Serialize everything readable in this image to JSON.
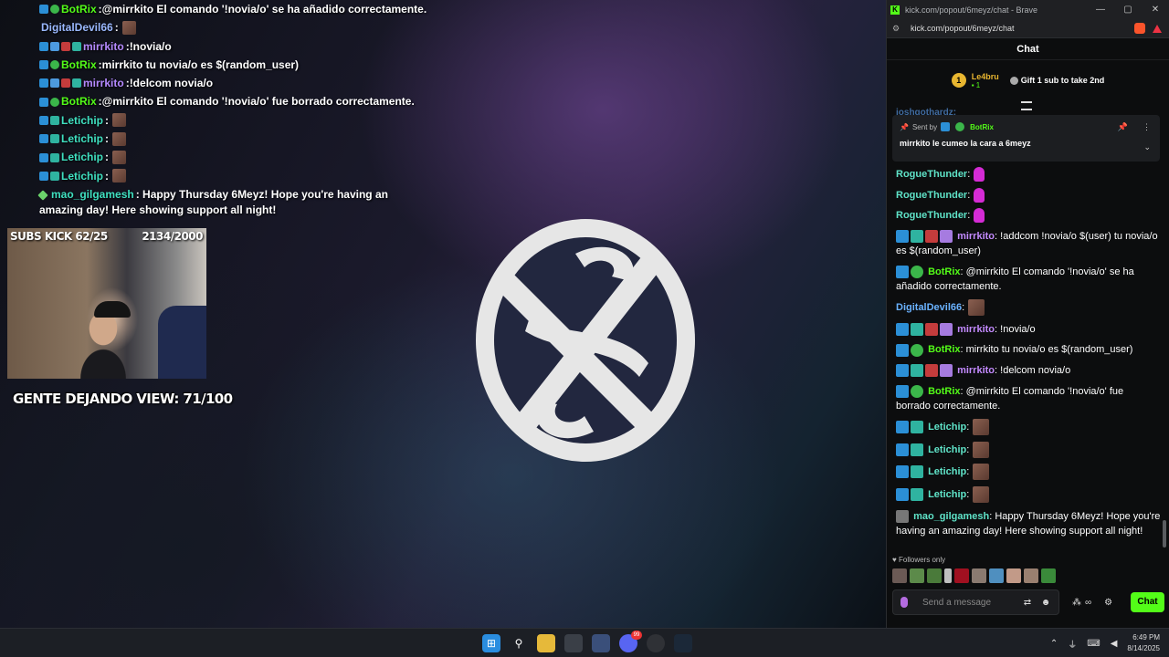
{
  "overlay": {
    "lines": [
      {
        "user": "BotRix",
        "sep": ":",
        "text": " @mirrkito El comando '!novia/o' se ha añadido correctamente.",
        "color": "green"
      },
      {
        "user": "DigitalDevil66",
        "sep": ":",
        "text": "",
        "color": "lblue"
      },
      {
        "user": "mirrkito",
        "sep": ":",
        "text": " !novia/o",
        "color": "purple"
      },
      {
        "user": "BotRix",
        "sep": ":",
        "text": " mirrkito tu novia/o es $(random_user)",
        "color": "green"
      },
      {
        "user": "mirrkito",
        "sep": ":",
        "text": " !delcom novia/o",
        "color": "purple"
      },
      {
        "user": "BotRix",
        "sep": ":",
        "text": " @mirrkito El comando '!novia/o' fue borrado correctamente.",
        "color": "green"
      },
      {
        "user": "Letichip",
        "sep": ":",
        "text": "",
        "color": "teal"
      },
      {
        "user": "Letichip",
        "sep": ":",
        "text": "",
        "color": "teal"
      },
      {
        "user": "Letichip",
        "sep": ":",
        "text": "",
        "color": "teal"
      },
      {
        "user": "Letichip",
        "sep": ":",
        "text": "",
        "color": "teal"
      }
    ],
    "last": {
      "user": "mao_gilgamesh",
      "sep": ":",
      "text": " Happy Thursday 6Meyz! Hope you're having an amazing day! Here showing support all night!"
    }
  },
  "webcam": {
    "subs_label": "SUBS KICK 62/25",
    "count_label": "2134/2000",
    "view_goal": "GENTE DEJANDO VIEW: 71/100"
  },
  "browser": {
    "window_title": "kick.com/popout/6meyz/chat - Brave",
    "url": "kick.com/popout/6meyz/chat",
    "controls": [
      "—",
      "▢",
      "✕"
    ]
  },
  "chat": {
    "header": "Chat",
    "gift": {
      "rank": "1",
      "user": "Le4bru",
      "subs": "1",
      "text": "Gift 1 sub to take 2nd"
    },
    "partial_user": "joshgothardz:",
    "pinned": {
      "sent_by": "Sent by",
      "bot": "BotRix",
      "message": "mirrkito le cumeo la cara a 6meyz"
    },
    "messages": [
      {
        "user": "RogueThunder",
        "text": "",
        "color": "teal",
        "emote": "pink"
      },
      {
        "user": "RogueThunder",
        "text": "",
        "color": "teal",
        "emote": "pink"
      },
      {
        "user": "RogueThunder",
        "text": "",
        "color": "teal",
        "emote": "pink"
      },
      {
        "user": "mirrkito",
        "text": " !addcom !novia/o $(user) tu novia/o es $(random_user)",
        "color": "purple"
      },
      {
        "user": "BotRix",
        "text": " @mirrkito El comando '!novia/o' se ha añadido correctamente.",
        "color": "green"
      },
      {
        "user": "DigitalDevil66",
        "text": "",
        "color": "blue",
        "emote": "face"
      },
      {
        "user": "mirrkito",
        "text": " !novia/o",
        "color": "purple"
      },
      {
        "user": "BotRix",
        "text": " mirrkito tu novia/o es $(random_user)",
        "color": "green"
      },
      {
        "user": "mirrkito",
        "text": " !delcom novia/o",
        "color": "purple"
      },
      {
        "user": "BotRix",
        "text": " @mirrkito El comando '!novia/o' fue borrado correctamente.",
        "color": "green"
      },
      {
        "user": "Letichip",
        "text": "",
        "color": "teal",
        "emote": "face"
      },
      {
        "user": "Letichip",
        "text": "",
        "color": "teal",
        "emote": "face"
      },
      {
        "user": "Letichip",
        "text": "",
        "color": "teal",
        "emote": "face"
      },
      {
        "user": "Letichip",
        "text": "",
        "color": "teal",
        "emote": "face"
      },
      {
        "user": "mao_gilgamesh",
        "text": " Happy Thursday 6Meyz! Hope you're having an amazing day! Here showing support all night!",
        "color": "teal"
      }
    ],
    "followers_only": "Followers only",
    "input_placeholder": "Send a message",
    "send_label": "Chat"
  },
  "taskbar": {
    "time": "6:49 PM",
    "date": "8/14/2025",
    "discord_badge": "99"
  },
  "colors": {
    "kick_green": "#53fc18",
    "purple": "#c38aff",
    "teal": "#5fe3c8"
  }
}
